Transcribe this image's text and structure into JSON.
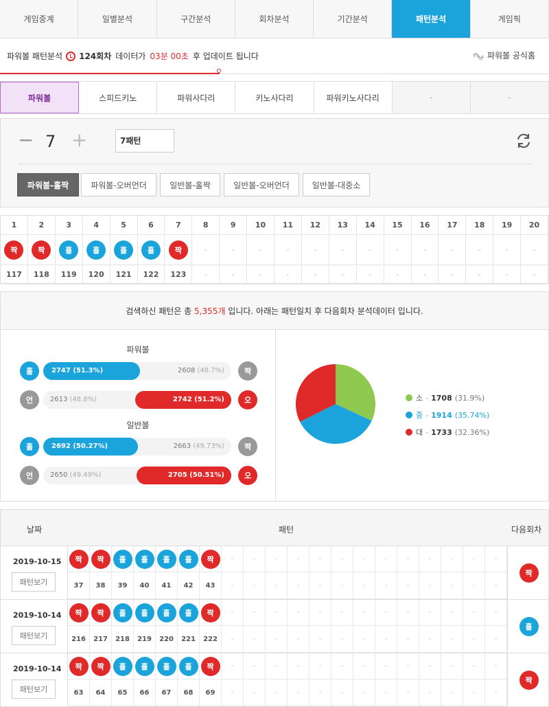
{
  "nav": {
    "tabs": [
      "게임중계",
      "일별분석",
      "구간분석",
      "회차분석",
      "기간분석",
      "패턴분석",
      "게임픽"
    ],
    "active": 5
  },
  "info": {
    "prefix": "파워볼 패턴분석",
    "round": "124회차",
    "mid": "데이터가",
    "time": "03분 00초",
    "suffix": "후 업데이트 됩니다",
    "official": "파워볼 공식홈"
  },
  "game_tabs": {
    "items": [
      "파워볼",
      "스피드키노",
      "파워사다리",
      "키노사다리",
      "파워키노사다리",
      "-",
      "-"
    ],
    "active": 0
  },
  "controls": {
    "minus": "−",
    "count": "7",
    "plus": "+",
    "pattern": "7패턴",
    "options": [
      "파워볼-홀짝",
      "파워볼-오버언더",
      "일반볼-홀짝",
      "일반볼-오버언더",
      "일반볼-대중소"
    ],
    "active": 0
  },
  "grid": {
    "headers": [
      "1",
      "2",
      "3",
      "4",
      "5",
      "6",
      "7",
      "8",
      "9",
      "10",
      "11",
      "12",
      "13",
      "14",
      "15",
      "16",
      "17",
      "18",
      "19",
      "20"
    ],
    "results": [
      "짝",
      "짝",
      "홀",
      "홀",
      "홀",
      "홀",
      "짝",
      "-",
      "-",
      "-",
      "-",
      "-",
      "-",
      "-",
      "-",
      "-",
      "-",
      "-",
      "-",
      "-"
    ],
    "rounds": [
      "117",
      "118",
      "119",
      "120",
      "121",
      "122",
      "123",
      "-",
      "-",
      "-",
      "-",
      "-",
      "-",
      "-",
      "-",
      "-",
      "-",
      "-",
      "-",
      "-"
    ]
  },
  "summary": {
    "pre": "검색하신 패턴은 총",
    "count": "5,355개",
    "post": "입니다. 아래는 패턴일치 후 다음회차 분석데이터 입니다."
  },
  "stats": {
    "powerball_title": "파워볼",
    "normal_title": "일반볼",
    "rows": [
      {
        "left": "홀",
        "right": "짝",
        "fill_side": "left",
        "fill_text": "2747 (51.3%)",
        "fill_pct": 51.3,
        "other_num": "2608",
        "other_pct": "(48.7%)"
      },
      {
        "left": "언",
        "right": "오",
        "fill_side": "right",
        "fill_text": "2742 (51.2%)",
        "fill_pct": 51.2,
        "other_num": "2613",
        "other_pct": "(48.8%)"
      },
      {
        "left": "홀",
        "right": "짝",
        "fill_side": "left",
        "fill_text": "2692 (50.27%)",
        "fill_pct": 50.27,
        "other_num": "2663",
        "other_pct": "(49.73%)"
      },
      {
        "left": "언",
        "right": "오",
        "fill_side": "right",
        "fill_text": "2705 (50.51%)",
        "fill_pct": 50.51,
        "other_num": "2650",
        "other_pct": "(49.49%)"
      }
    ],
    "pie": [
      {
        "label": "소",
        "value": "1708",
        "pct": "(31.9%)",
        "share": 31.9,
        "color": "#8ec84e"
      },
      {
        "label": "중",
        "value": "1914",
        "pct": "(35.74%)",
        "share": 35.74,
        "color": "#1ba4dc"
      },
      {
        "label": "대",
        "value": "1733",
        "pct": "(32.36%)",
        "share": 32.36,
        "color": "#e02a2a"
      }
    ]
  },
  "history": {
    "head": {
      "date": "날짜",
      "pattern": "패턴",
      "next": "다음회차"
    },
    "button_label": "패턴보기",
    "rows": [
      {
        "date": "2019-10-15",
        "results": [
          "짝",
          "짝",
          "홀",
          "홀",
          "홀",
          "홀",
          "짝"
        ],
        "rounds": [
          "37",
          "38",
          "39",
          "40",
          "41",
          "42",
          "43"
        ],
        "next": "짝"
      },
      {
        "date": "2019-10-14",
        "results": [
          "짝",
          "짝",
          "홀",
          "홀",
          "홀",
          "홀",
          "짝"
        ],
        "rounds": [
          "216",
          "217",
          "218",
          "219",
          "220",
          "221",
          "222"
        ],
        "next": "홀"
      },
      {
        "date": "2019-10-14",
        "results": [
          "짝",
          "짝",
          "홀",
          "홀",
          "홀",
          "홀",
          "짝"
        ],
        "rounds": [
          "63",
          "64",
          "65",
          "66",
          "67",
          "68",
          "69"
        ],
        "next": "짝"
      }
    ],
    "dash": "-"
  },
  "colors": {
    "accent": "#1ba4dc",
    "red": "#e02a2a",
    "purple": "#b36bcc",
    "green": "#8ec84e"
  }
}
